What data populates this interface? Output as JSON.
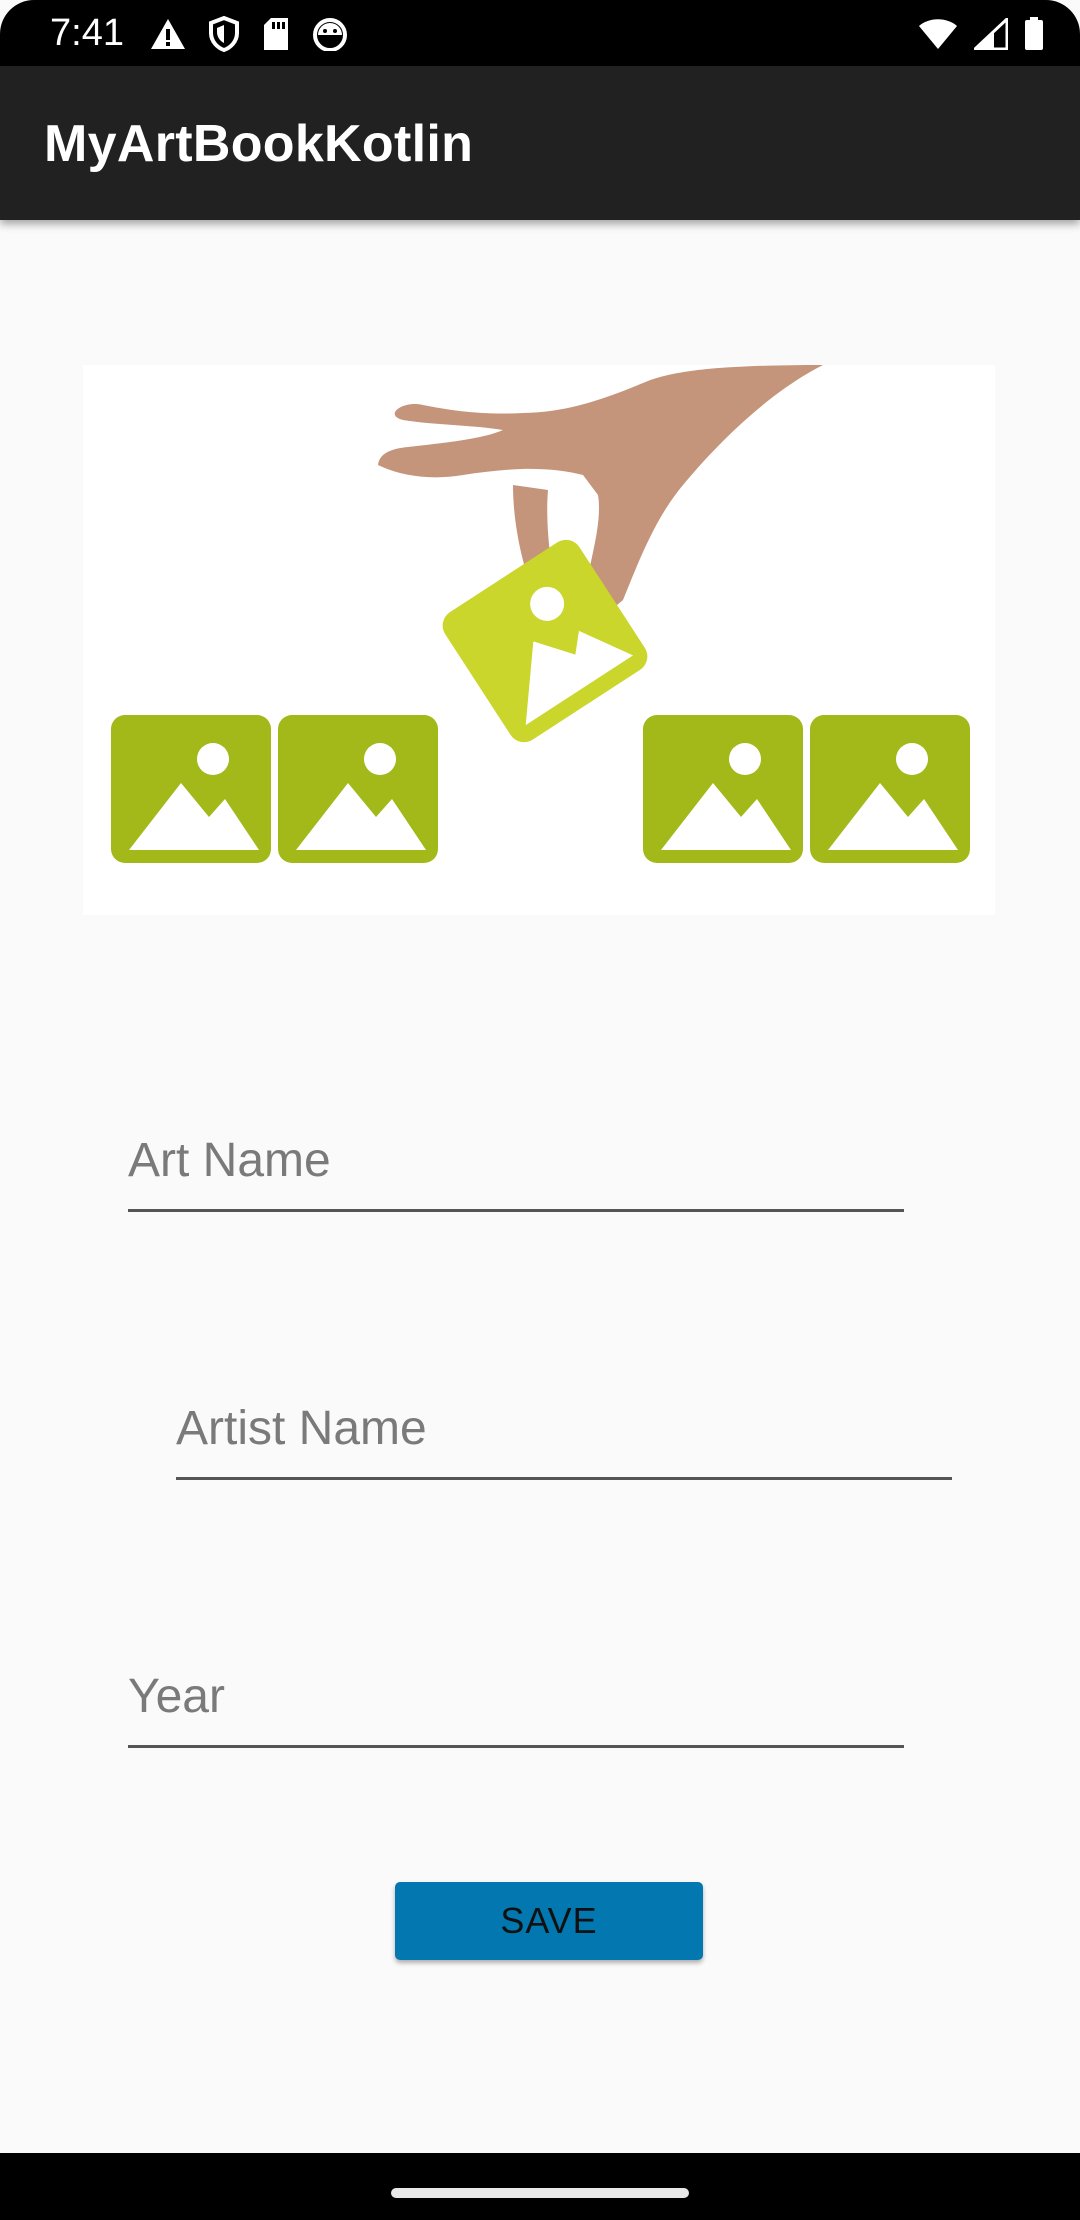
{
  "status_bar": {
    "time": "7:41",
    "left_icons": [
      "alert-icon",
      "shield-icon",
      "sd-card-icon",
      "android-debug-icon"
    ],
    "right_icons": [
      "wifi-icon",
      "cell-signal-icon",
      "battery-icon"
    ]
  },
  "app_bar": {
    "title": "MyArtBookKotlin"
  },
  "image": {
    "icon": "image-placeholder-illustration"
  },
  "form": {
    "art_name_placeholder": "Art Name",
    "artist_name_placeholder": "Artist Name",
    "year_placeholder": "Year",
    "save_label": "SAVE"
  },
  "colors": {
    "app_bar": "#212121",
    "background": "#fafafa",
    "button": "#0277b0",
    "image_green": "#a2b919",
    "image_green_light": "#cbd62c",
    "hand": "#c4957b"
  }
}
